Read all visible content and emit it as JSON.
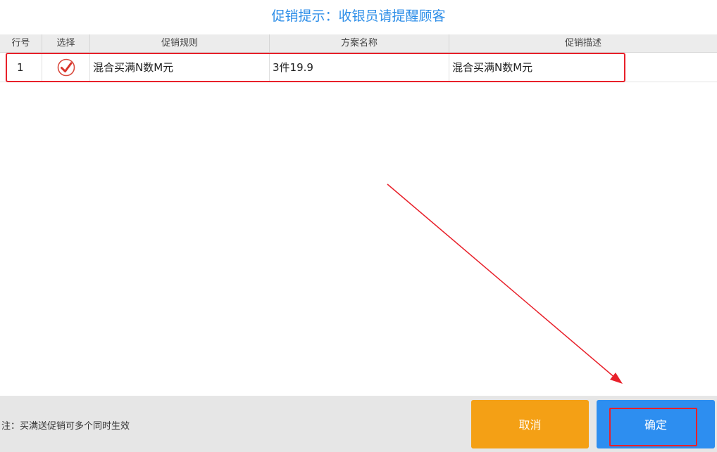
{
  "dialog": {
    "title": "促销提示：收银员请提醒顾客"
  },
  "table": {
    "columns": [
      "行号",
      "选择",
      "促销规则",
      "方案名称",
      "促销描述"
    ],
    "rows": [
      {
        "row_no": "1",
        "selected": true,
        "rule": "混合买满N数M元",
        "plan_name": "3件19.9",
        "description": "混合买满N数M元"
      }
    ]
  },
  "footer": {
    "note": "注：买满送促销可多个同时生效",
    "cancel_label": "取消",
    "confirm_label": "确定"
  },
  "colors": {
    "title": "#2d8ee8",
    "cancel": "#f4a015",
    "confirm": "#2d8ef0",
    "annotation": "#e8202a"
  },
  "icons": {
    "checkbox": "checkmark-circle-icon"
  }
}
